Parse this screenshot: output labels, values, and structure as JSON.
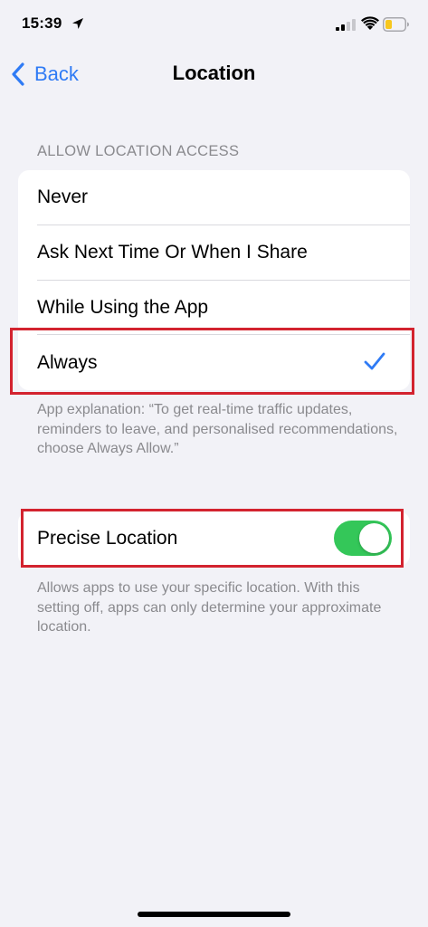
{
  "status_bar": {
    "time": "15:39",
    "icons": [
      "location-arrow-icon",
      "signal-icon",
      "wifi-icon",
      "battery-icon"
    ]
  },
  "nav": {
    "back_label": "Back",
    "title": "Location"
  },
  "location_access": {
    "header": "ALLOW LOCATION ACCESS",
    "options": [
      {
        "label": "Never",
        "selected": false
      },
      {
        "label": "Ask Next Time Or When I Share",
        "selected": false
      },
      {
        "label": "While Using the App",
        "selected": false
      },
      {
        "label": "Always",
        "selected": true
      }
    ],
    "explanation": "App explanation: “To get real-time traffic updates, reminders to leave, and personalised recommendations, choose Always Allow.”"
  },
  "precise_location": {
    "label": "Precise Location",
    "enabled": true,
    "footer": "Allows apps to use your specific location. With this setting off, apps can only determine your approximate location."
  },
  "colors": {
    "background": "#f2f2f7",
    "accent": "#2f7bf5",
    "toggle_on": "#34c759",
    "highlight": "#d3232f",
    "secondary_text": "#8a8a8e"
  }
}
